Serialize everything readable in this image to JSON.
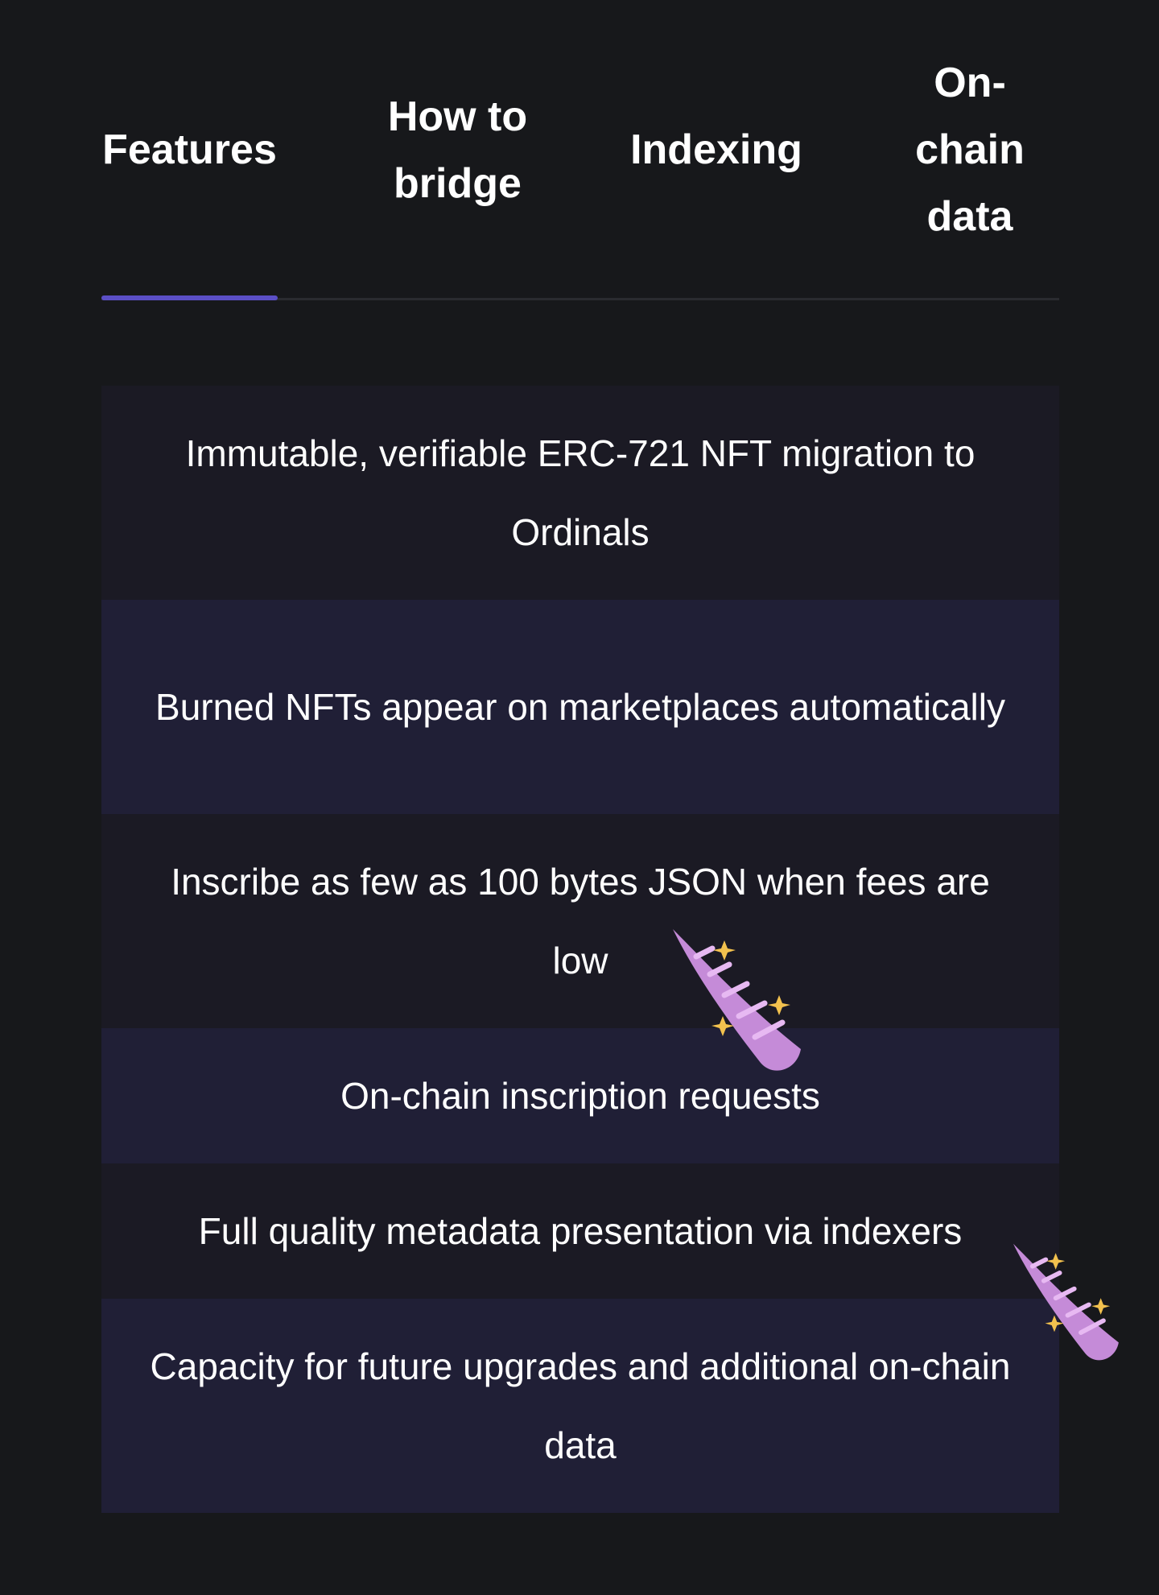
{
  "tabs": [
    {
      "label": "Features",
      "active": true
    },
    {
      "label": "How to bridge",
      "active": false
    },
    {
      "label": "Indexing",
      "active": false
    },
    {
      "label": "On-chain data",
      "active": false
    }
  ],
  "features": [
    {
      "text": "Immutable, verifiable ERC-721 NFT migration to Ordinals"
    },
    {
      "text": "Burned NFTs appear on marketplaces automatically"
    },
    {
      "text": "Inscribe as few as 100 bytes JSON when fees are low"
    },
    {
      "text": "On-chain inscription requests"
    },
    {
      "text": "Full quality metadata presentation via indexers"
    },
    {
      "text": "Capacity for future upgrades and additional on-chain data"
    }
  ],
  "decorations": [
    {
      "icon": "unicorn-horn-sparkles-icon"
    },
    {
      "icon": "unicorn-horn-sparkles-icon"
    }
  ],
  "colors": {
    "page_background": "#17181b",
    "accent": "#5b4fc6",
    "row_dark": "#1b1a24",
    "row_indigo": "#201f36",
    "horn": "#c58bd8",
    "sparkle": "#f2c14e"
  }
}
